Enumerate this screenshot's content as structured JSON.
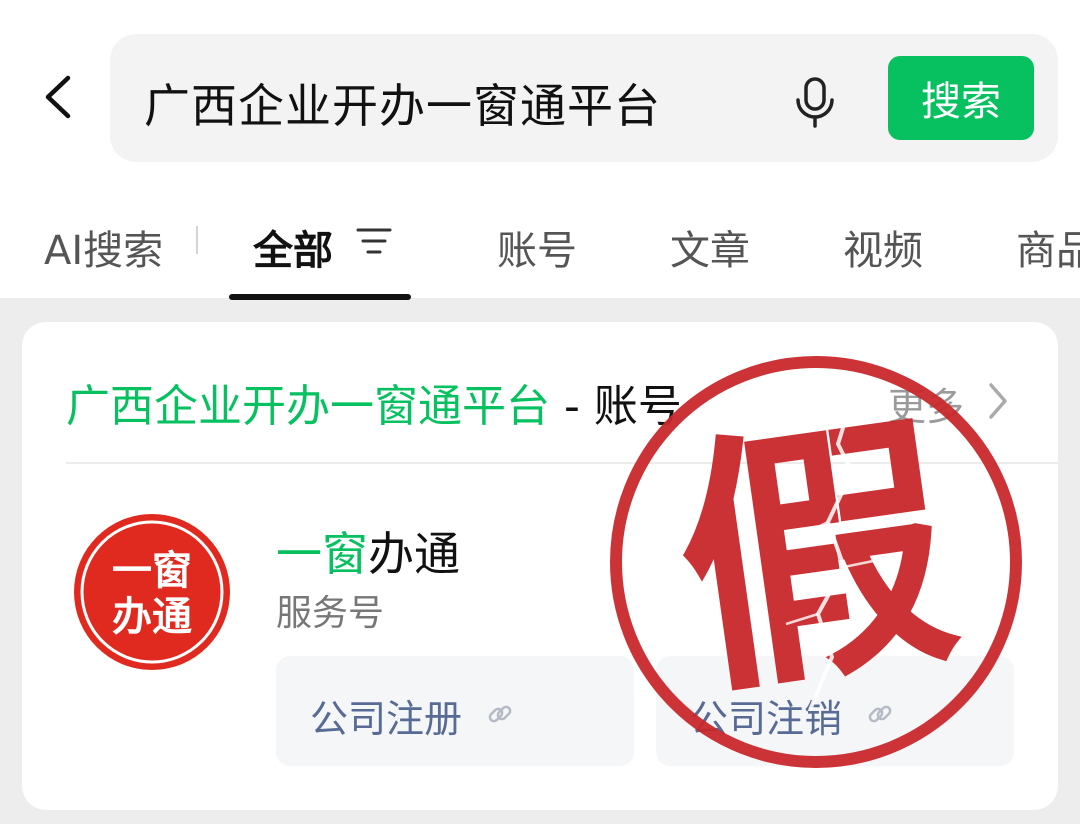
{
  "search": {
    "query": "广西企业开办一窗通平台",
    "button_label": "搜索"
  },
  "tabs": [
    {
      "label": "AI搜索"
    },
    {
      "label": "全部"
    },
    {
      "label": "账号"
    },
    {
      "label": "文章"
    },
    {
      "label": "视频"
    },
    {
      "label": "商品"
    }
  ],
  "result": {
    "title_keyword": "广西企业开办一窗通平台",
    "title_suffix": " - 账号",
    "more_label": "更多",
    "account": {
      "name_highlight": "一窗",
      "name_rest": "办通",
      "type": "服务号",
      "logo_line1": "一窗",
      "logo_line2": "办通",
      "logo_color": "#e02a1f"
    },
    "services": [
      {
        "label": "公司注册"
      },
      {
        "label": "公司注销"
      }
    ]
  },
  "stamp": {
    "text": "假",
    "color": "#c8282c"
  },
  "colors": {
    "accent": "#07c160",
    "link": "#576b95"
  }
}
